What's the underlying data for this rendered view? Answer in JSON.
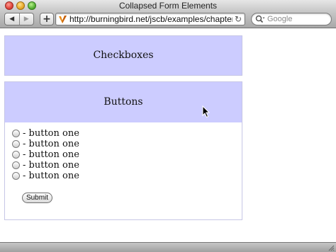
{
  "window": {
    "title": "Collapsed Form Elements"
  },
  "toolbar": {
    "back_icon": "◀",
    "forward_icon": "▶",
    "add_label": "+",
    "url": "http://burningbird.net/jscb/examples/chapter13",
    "reload_icon": "↻",
    "search_placeholder": "Google"
  },
  "page": {
    "panels": [
      {
        "title": "Checkboxes"
      },
      {
        "title": "Buttons",
        "radios": [
          {
            "label": "- button one"
          },
          {
            "label": "- button one"
          },
          {
            "label": "- button one"
          },
          {
            "label": "- button one"
          },
          {
            "label": "- button one"
          }
        ],
        "submit_label": "Submit"
      }
    ]
  },
  "colors": {
    "panel_header_bg": "#ccccff",
    "panel_border": "#c6c6e6"
  }
}
